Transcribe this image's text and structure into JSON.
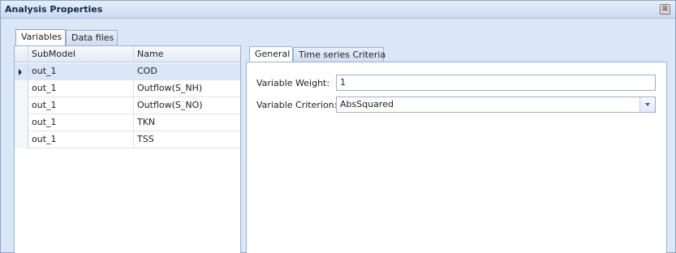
{
  "window": {
    "title": "Analysis Properties",
    "close_glyph": "⊠"
  },
  "outer_tabs": [
    {
      "label": "Variables",
      "active": true
    },
    {
      "label": "Data files",
      "active": false
    }
  ],
  "grid": {
    "columns": [
      "SubModel",
      "Name"
    ],
    "selected_index": 0,
    "rows": [
      {
        "submodel": "out_1",
        "name": "COD"
      },
      {
        "submodel": "out_1",
        "name": "Outflow(S_NH)"
      },
      {
        "submodel": "out_1",
        "name": "Outflow(S_NO)"
      },
      {
        "submodel": "out_1",
        "name": "TKN"
      },
      {
        "submodel": "out_1",
        "name": "TSS"
      }
    ]
  },
  "inner_tabs": [
    {
      "label": "General",
      "active": true
    },
    {
      "label": "Time series Criteria",
      "active": false
    }
  ],
  "general": {
    "weight_label": "Variable Weight:",
    "weight_value": "1",
    "criterion_label": "Variable Criterion:",
    "criterion_value": "AbsSquared"
  },
  "icons": {
    "close": "close-icon",
    "row_indicator": "row-indicator-arrow-icon",
    "dropdown": "chevron-down-icon"
  }
}
